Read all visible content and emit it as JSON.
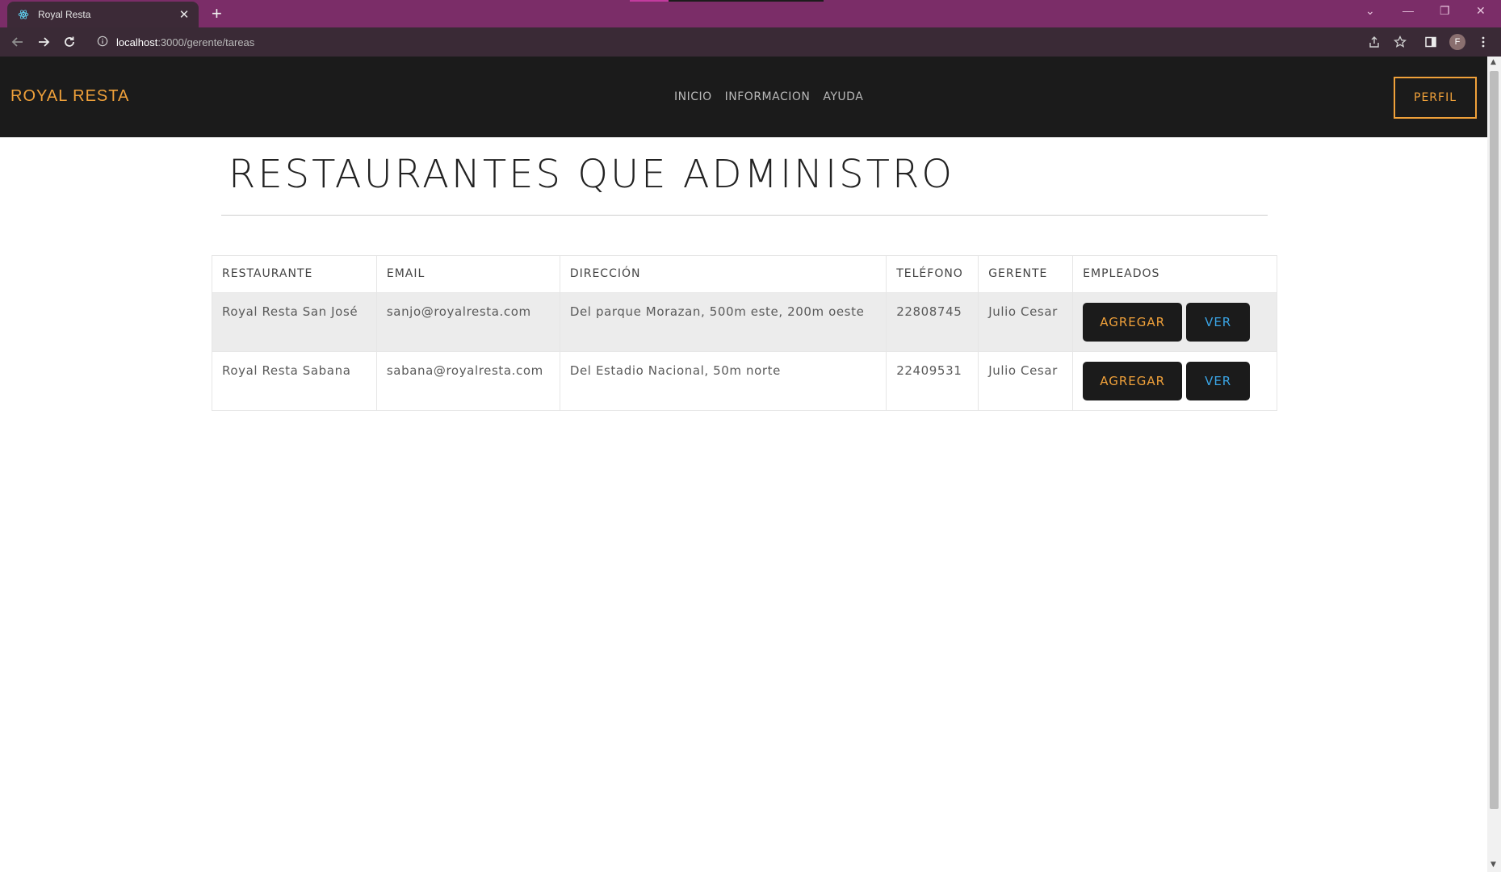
{
  "browser": {
    "tab_title": "Royal Resta",
    "url_host": "localhost",
    "url_path": ":3000/gerente/tareas",
    "profile_initial": "F"
  },
  "site": {
    "brand": "ROYAL RESTA",
    "nav": [
      "INICIO",
      "INFORMACION",
      "AYUDA"
    ],
    "profile_button": "PERFIL"
  },
  "page": {
    "title": "RESTAURANTES QUE ADMINISTRO"
  },
  "table": {
    "headers": [
      "RESTAURANTE",
      "EMAIL",
      "DIRECCIÓN",
      "TELÉFONO",
      "GERENTE",
      "EMPLEADOS"
    ],
    "rows": [
      {
        "restaurante": "Royal Resta San José",
        "email": "sanjo@royalresta.com",
        "direccion": "Del parque Morazan, 500m este, 200m oeste",
        "telefono": "22808745",
        "gerente": "Julio Cesar",
        "add_label": "AGREGAR",
        "view_label": "VER"
      },
      {
        "restaurante": "Royal Resta Sabana",
        "email": "sabana@royalresta.com",
        "direccion": "Del Estadio Nacional, 50m norte",
        "telefono": "22409531",
        "gerente": "Julio Cesar",
        "add_label": "AGREGAR",
        "view_label": "VER"
      }
    ]
  },
  "colors": {
    "accent": "#f0a13a",
    "link_blue": "#3aa3e3",
    "header_bg": "#1b1b1b",
    "browser_frame": "#7b2d68"
  }
}
